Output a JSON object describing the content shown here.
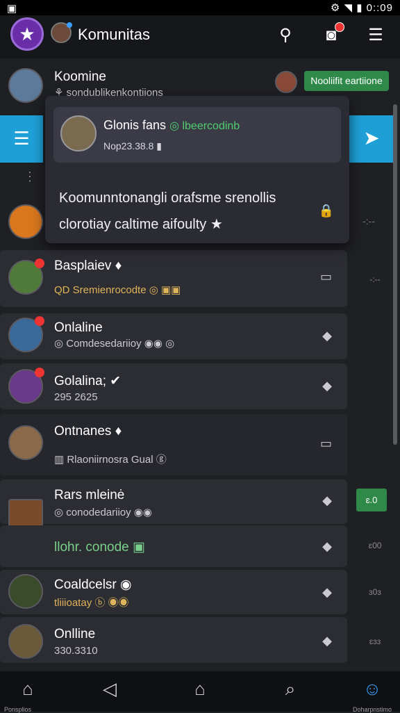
{
  "status_bar": {
    "left_icon": "▣",
    "right_text": "⚙ ◥ ▮ 0::09"
  },
  "app": {
    "title": "Komunitas",
    "logo_icon": "★"
  },
  "header_icons": {
    "profile": "⚲",
    "notification": "◙",
    "menu": "☰"
  },
  "top_item": {
    "name": "Koomine",
    "sub": "⚘ sondublikenkontiions",
    "notify_label": "Nooliifit eartiione"
  },
  "popup": {
    "card_name": "Glonis fans",
    "card_tag": "◎ lbeercodinb",
    "card_sub": "Nop23.38.8 ▮",
    "text": "Koomunntonangli orafsme srenollis clorotiay caltime aifoulty ★",
    "lock_icon": "🔒"
  },
  "rows": [
    {
      "name": "Basplaiev ♦",
      "sub": "QD Sremienrocodte ◎ ▣▣"
    },
    {
      "name": "Onlaline",
      "sub": "◎ Comdesedariioy ◉◉ ◎"
    },
    {
      "name": "Golalina; ✔",
      "sub": "295 2625"
    },
    {
      "name": "Ontnanes ♦",
      "sub": "▥ Rlaoniirnosra Gual ⓖ"
    },
    {
      "name": "Rars mleinė",
      "sub": "◎ conodedariioy ◉◉"
    },
    {
      "name": "llohr. conode ▣",
      "sub": ""
    },
    {
      "name": "Coaldcelsr ◉",
      "sub": "tliiioatay ⓑ ◉◉"
    },
    {
      "name": "Onlline",
      "sub": "330.3310"
    }
  ],
  "side_labels": [
    "-:--",
    "-:--",
    "",
    "",
    "",
    "ɛ00",
    "ɜ0ɜ",
    "ɛɜɜ"
  ],
  "green_tag": "ɛ.0",
  "nav": {
    "home_label": "Ponsplios",
    "back_icon": "◁",
    "home_icon": "⌂",
    "search_icon": "⌕",
    "profile_label": "Doharpnstimo"
  }
}
